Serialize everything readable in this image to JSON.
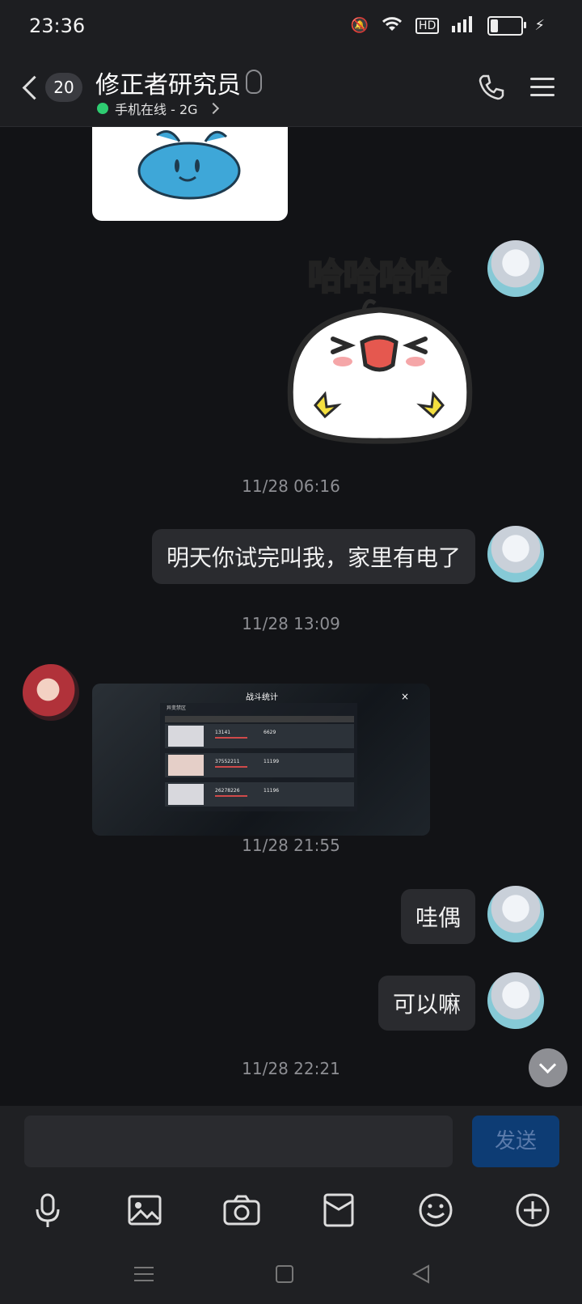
{
  "status": {
    "time": "23:36"
  },
  "header": {
    "unread_count": "20",
    "title": "修正者研究员",
    "subtitle": "手机在线 - 2G"
  },
  "messages": {
    "ts1": "11/28 06:16",
    "msg1": "明天你试完叫我，家里有电了",
    "ts2": "11/28 13:09",
    "ts3": "11/28 21:55",
    "msg2": "哇偶",
    "msg3": "可以嘛",
    "ts4": "11/28 22:21"
  },
  "stickers": {
    "haha_text": "哈哈哈哈"
  },
  "screenshot": {
    "title": "战斗统计",
    "area": "异变禁区",
    "rows": [
      {
        "v1": "13141",
        "v2": "6629"
      },
      {
        "v1": "37552211",
        "v2": "11199"
      },
      {
        "v1": "26278226",
        "v2": "11196"
      }
    ]
  },
  "input": {
    "placeholder": "",
    "send_label": "发送"
  },
  "colors": {
    "accent_send": "#0d3c74",
    "online": "#2ecc71",
    "background": "#121316"
  }
}
